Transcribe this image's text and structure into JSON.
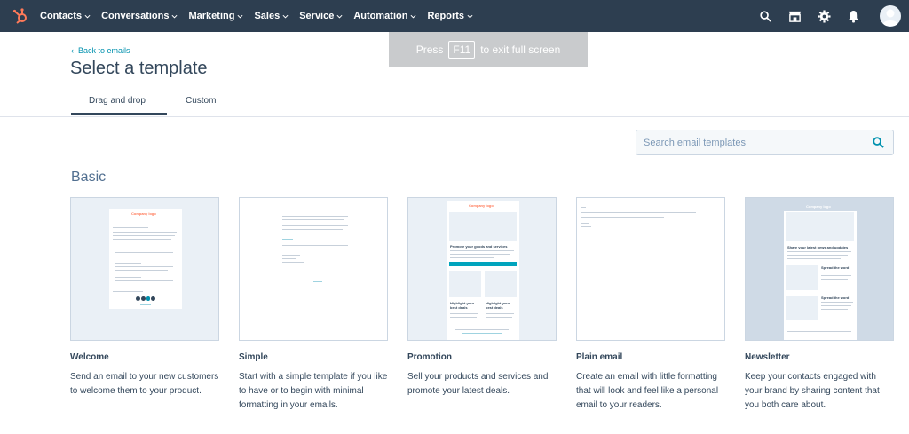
{
  "nav": {
    "items": [
      {
        "label": "Contacts"
      },
      {
        "label": "Conversations"
      },
      {
        "label": "Marketing"
      },
      {
        "label": "Sales"
      },
      {
        "label": "Service"
      },
      {
        "label": "Automation"
      },
      {
        "label": "Reports"
      }
    ]
  },
  "overlay": {
    "press": "Press",
    "key": "F11",
    "rest": "to exit full screen"
  },
  "header": {
    "back": "Back to emails",
    "title": "Select a template"
  },
  "tabs": [
    {
      "label": "Drag and drop"
    },
    {
      "label": "Custom"
    }
  ],
  "search": {
    "placeholder": "Search email templates"
  },
  "section": "Basic",
  "templates": [
    {
      "name": "Welcome",
      "desc": "Send an email to your new customers to welcome them to your product."
    },
    {
      "name": "Simple",
      "desc": "Start with a simple template if you like to have or to begin with minimal formatting in your emails."
    },
    {
      "name": "Promotion",
      "desc": "Sell your products and services and promote your latest deals."
    },
    {
      "name": "Plain email",
      "desc": "Create an email with little formatting that will look and feel like a personal email to your readers."
    },
    {
      "name": "Newsletter",
      "desc": "Keep your contacts engaged with your brand by sharing content that you both care about."
    }
  ],
  "thumb": {
    "company_logo": "Company logo",
    "promo_heading": "Promote your goods and services",
    "deal_heading": "Highlight your best deals",
    "news_heading": "Share your latest news and updates",
    "spread": "Spread the word"
  },
  "colors": {
    "nav_bg": "#2d3e50",
    "accent": "#0091ae",
    "brand": "#ff7a59"
  }
}
